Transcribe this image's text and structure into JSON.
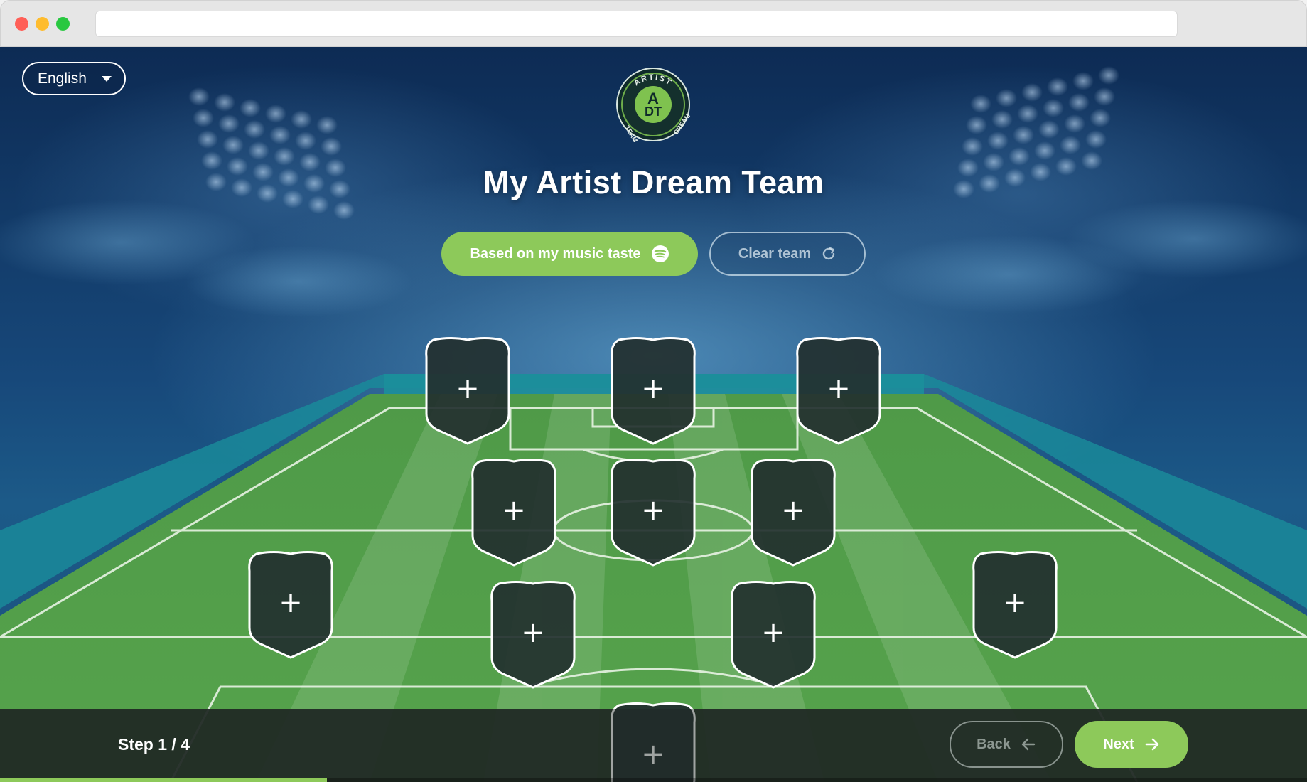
{
  "browser": {
    "url": ""
  },
  "colors": {
    "accent": "#8dc95a",
    "slot_fill": "#23302f",
    "slot_border": "#ffffff",
    "bottom_bar": "#20282a"
  },
  "language": {
    "selected": "English",
    "icon": "chevron-down-icon"
  },
  "logo": {
    "top_text": "ARTIST",
    "left_text": "TEAM",
    "right_text": "DREAM",
    "monogram_top": "A",
    "monogram_bottom": "DT"
  },
  "title": "My Artist Dream Team",
  "buttons": {
    "music_taste": {
      "label": "Based on my music taste",
      "icon": "spotify-icon"
    },
    "clear_team": {
      "label": "Clear team",
      "icon": "refresh-icon"
    }
  },
  "slots": {
    "count": 12,
    "symbol": "+"
  },
  "footer": {
    "step": "Step 1 / 4",
    "progress": 0.25,
    "back": {
      "label": "Back",
      "icon": "arrow-left-icon"
    },
    "next": {
      "label": "Next",
      "icon": "arrow-right-icon"
    }
  }
}
